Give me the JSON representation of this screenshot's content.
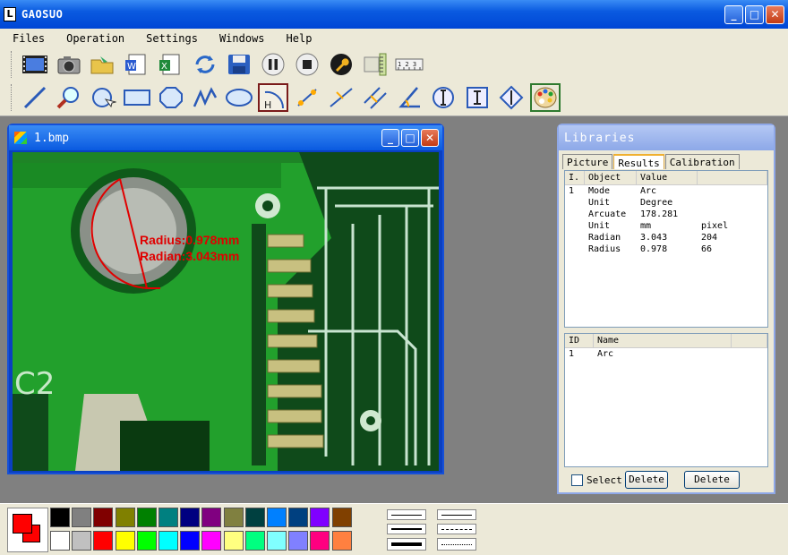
{
  "app": {
    "title": "GAOSUO"
  },
  "menu": [
    "Files",
    "Operation",
    "Settings",
    "Windows",
    "Help"
  ],
  "child_window": {
    "title": "1.bmp"
  },
  "overlay": {
    "radius_text": "Radius:0.978mm",
    "radian_text": "Radian:3.043mm"
  },
  "libraries": {
    "title": "Libraries",
    "tabs": [
      "Picture",
      "Results",
      "Calibration"
    ],
    "active_tab": "Results",
    "results_headers": [
      "I.",
      "Object",
      "Value",
      ""
    ],
    "results_rows": [
      [
        "1",
        "Mode",
        "Arc",
        ""
      ],
      [
        "",
        "Unit",
        "Degree",
        ""
      ],
      [
        "",
        "Arcuate",
        "178.281",
        ""
      ],
      [
        "",
        "Unit",
        "mm",
        "pixel"
      ],
      [
        "",
        "Radian",
        "3.043",
        "204"
      ],
      [
        "",
        "Radius",
        "0.978",
        "66"
      ]
    ],
    "list_headers": [
      "ID",
      "Name"
    ],
    "list_rows": [
      [
        "1",
        "Arc"
      ]
    ],
    "select_label": "Select",
    "delete1_label": "Delete",
    "delete2_label": "Delete"
  },
  "palette": {
    "primary": "#ff0000",
    "top_row": [
      "#000000",
      "#808080",
      "#800000",
      "#808000",
      "#008000",
      "#008080",
      "#000080",
      "#800080",
      "#808040",
      "#004040",
      "#0080ff",
      "#004080",
      "#8000ff",
      "#804000"
    ],
    "bottom_row": [
      "#ffffff",
      "#c0c0c0",
      "#ff0000",
      "#ffff00",
      "#00ff00",
      "#00ffff",
      "#0000ff",
      "#ff00ff",
      "#ffff80",
      "#00ff80",
      "#80ffff",
      "#8080ff",
      "#ff0080",
      "#ff8040"
    ]
  },
  "icons": {
    "toolbar1": [
      "film-icon",
      "camera-icon",
      "open-folder-icon",
      "word-icon",
      "excel-icon",
      "refresh-icon",
      "save-icon",
      "pause-icon",
      "stop-icon",
      "wrench-icon",
      "vertical-ruler-icon",
      "ruler-icon"
    ],
    "toolbar2": [
      "line-tool-icon",
      "magnifier-icon",
      "circle-tool-icon",
      "rectangle-tool-icon",
      "polygon-tool-icon",
      "polyline-tool-icon",
      "ellipse-tool-icon",
      "arc-tool-icon",
      "point-distance-icon",
      "point-line-icon",
      "parallel-icon",
      "angle-icon",
      "width-measure-icon",
      "height-measure-icon",
      "vertical-distance-icon",
      "palette-icon"
    ]
  }
}
